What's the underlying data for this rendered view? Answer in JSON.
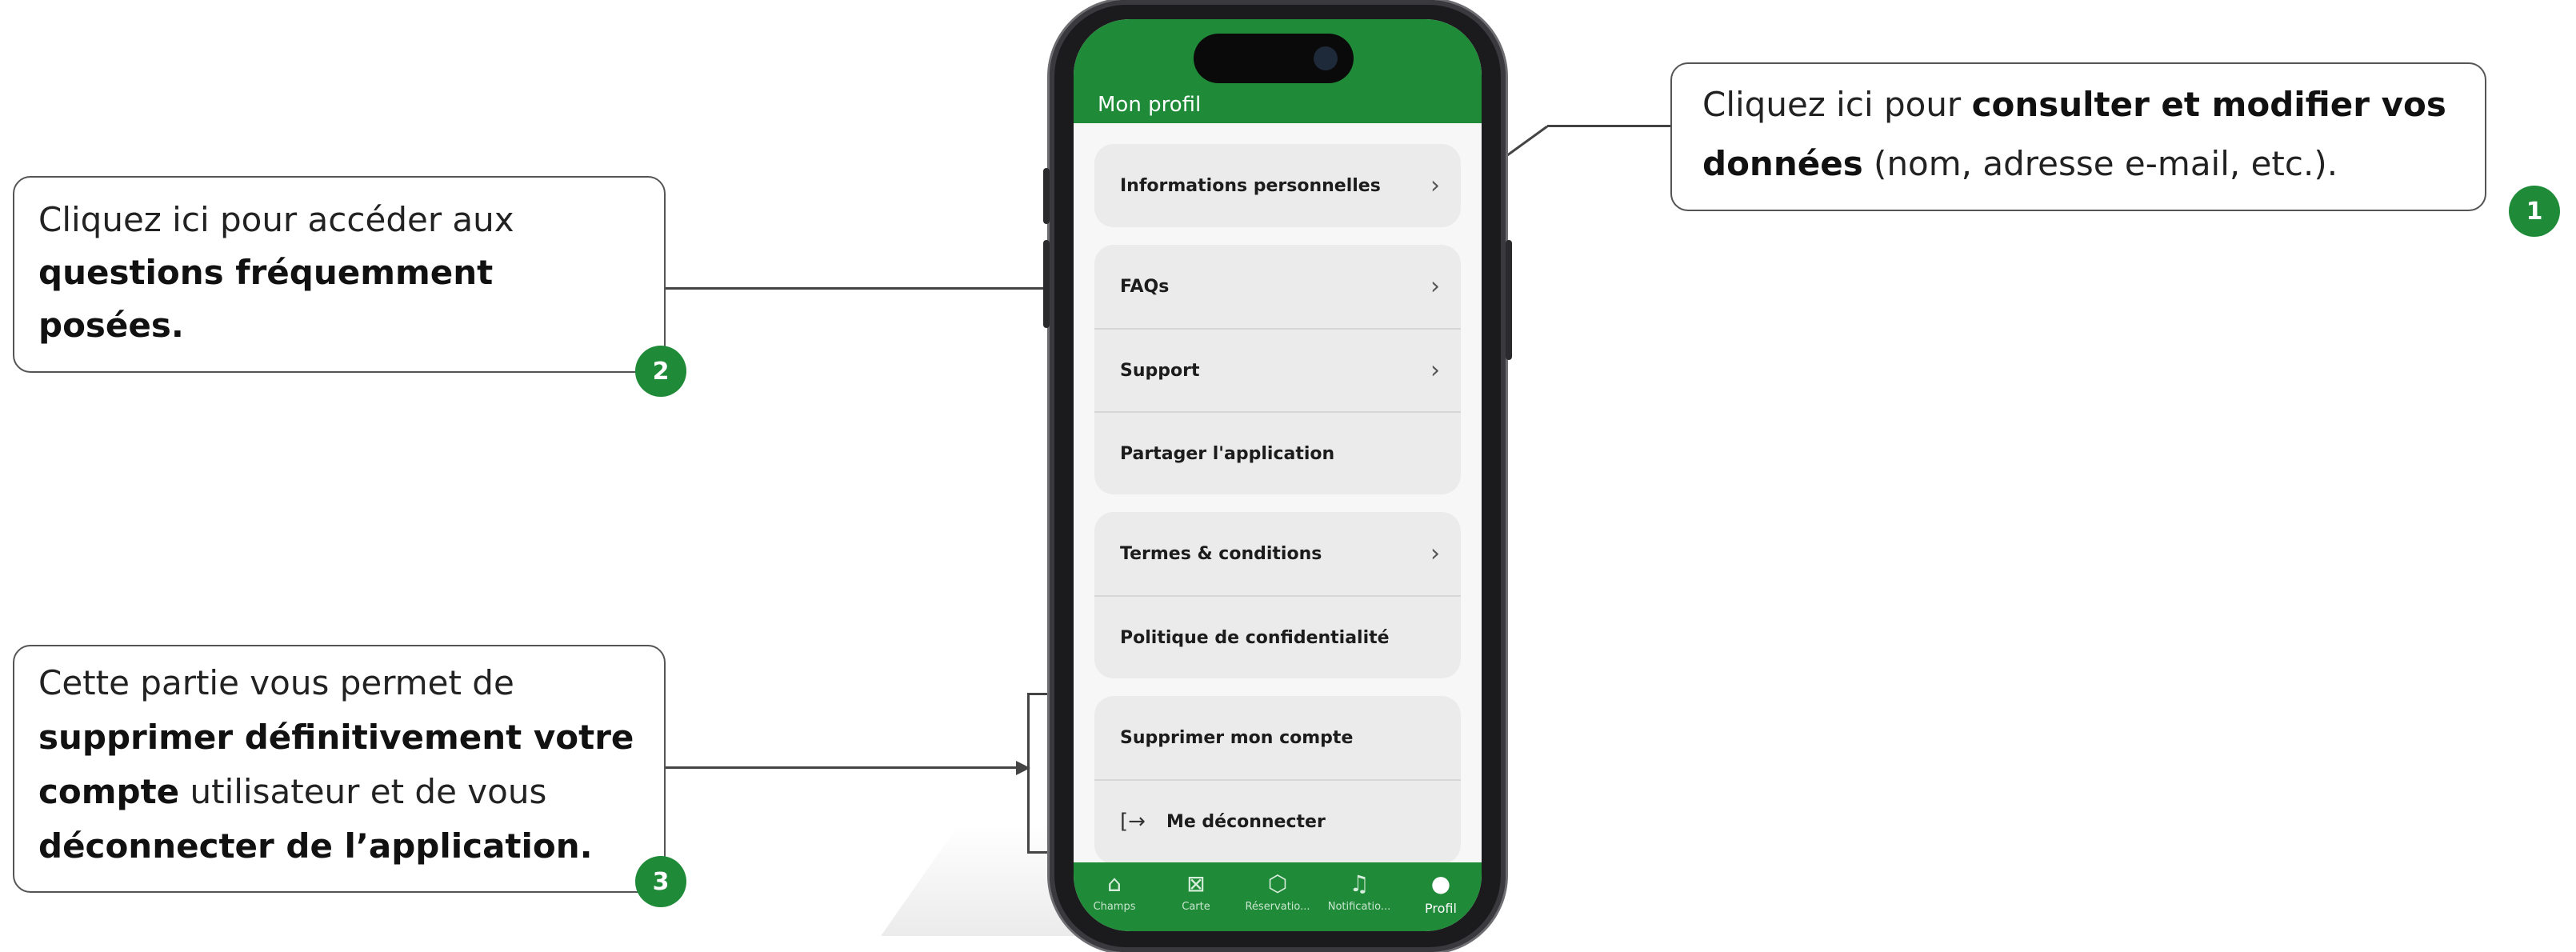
{
  "phone": {
    "title": "Mon profil",
    "menu": {
      "personal_info": "Informations personnelles",
      "faqs": "FAQs",
      "support": "Support",
      "share_app": "Partager l'application",
      "terms": "Termes & conditions",
      "privacy": "Politique de confidentialité",
      "delete_account": "Supprimer mon compte",
      "logout": "Me déconnecter"
    },
    "chevron": "›",
    "tabs": [
      {
        "label": "Champs",
        "icon": "home-icon"
      },
      {
        "label": "Carte",
        "icon": "map-icon"
      },
      {
        "label": "Réservatio...",
        "icon": "box-icon"
      },
      {
        "label": "Notificatio...",
        "icon": "bell-icon"
      },
      {
        "label": "Profil",
        "icon": "user-icon"
      }
    ]
  },
  "callouts": {
    "c1": {
      "pre": "Cliquez ici pour ",
      "bold1": "consulter et modifier vos",
      "bold2": "données",
      "post": " (nom, adresse e-mail, etc.).",
      "badge": "1"
    },
    "c2": {
      "pre": "Cliquez ici pour accéder aux",
      "bold1": "questions fréquemment",
      "bold2": "posées.",
      "badge": "2"
    },
    "c3": {
      "line1": "Cette partie vous permet de",
      "bold1": "supprimer définitivement votre",
      "bold2": "compte",
      "post": " utilisateur et de vous",
      "bold3": "déconnecter de l’application.",
      "badge": "3"
    }
  },
  "colors": {
    "accent": "#1f8a38",
    "card": "#ebebeb"
  }
}
